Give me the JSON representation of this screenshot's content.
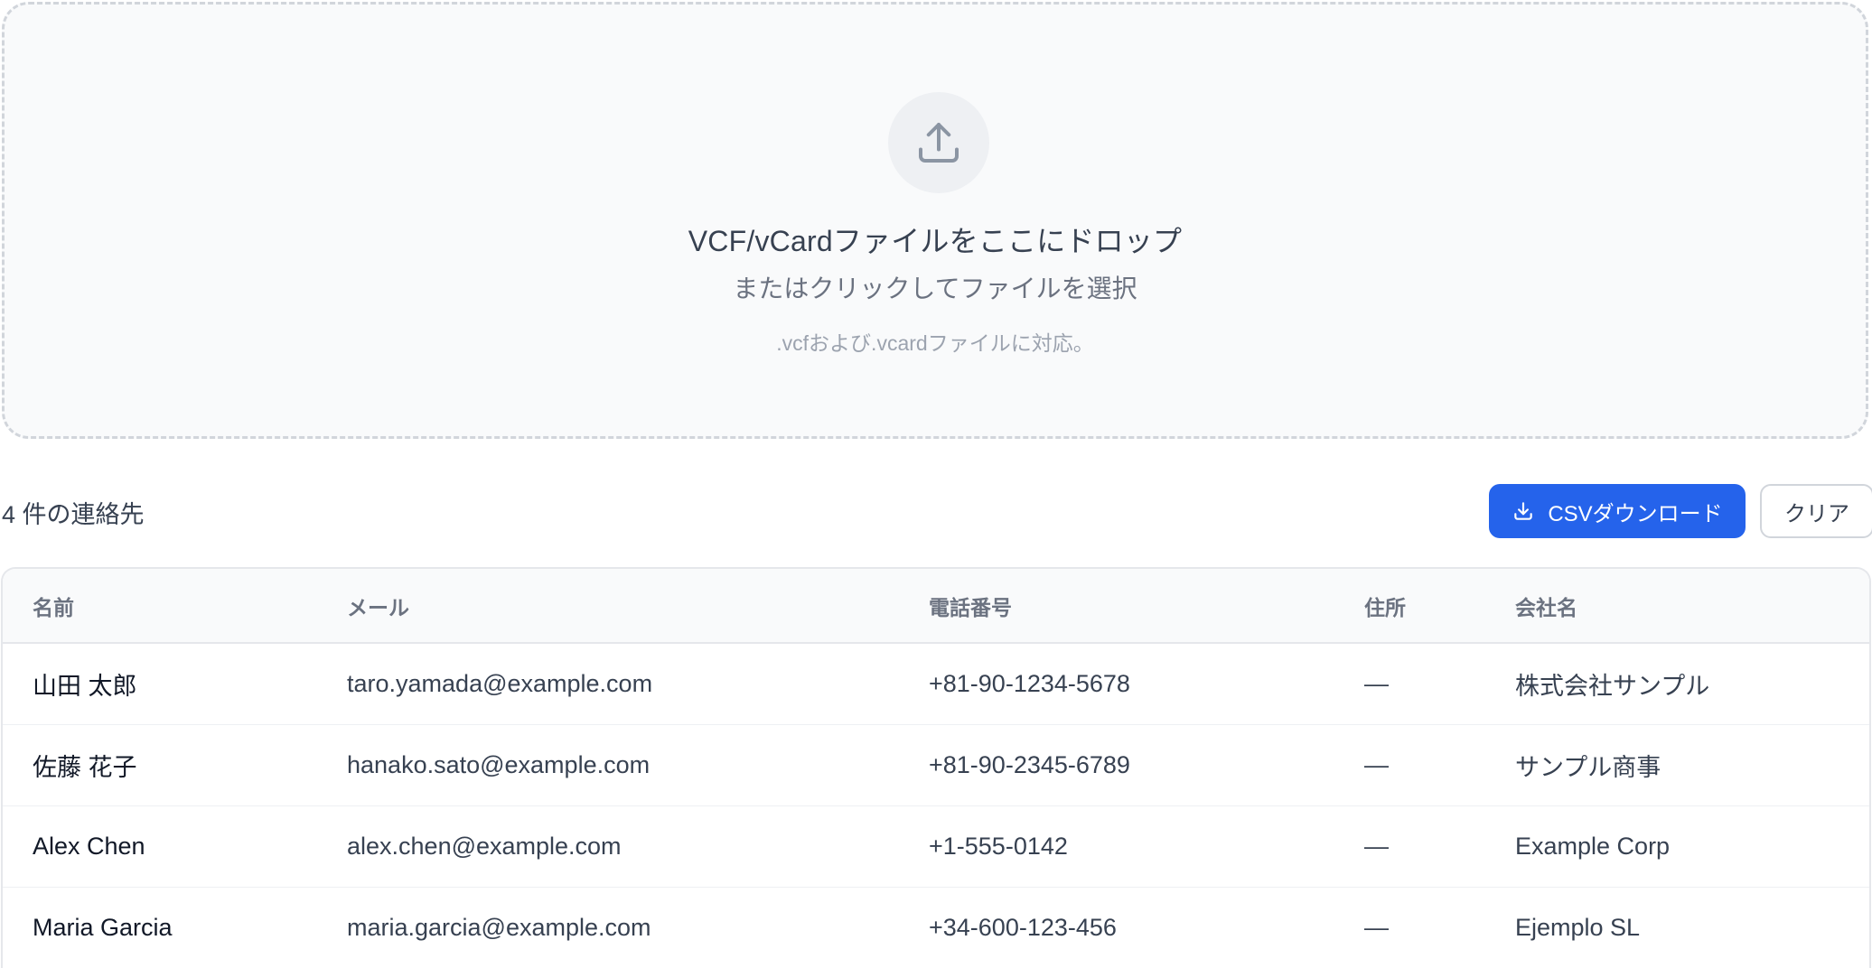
{
  "dropzone": {
    "icon": "upload-icon",
    "title": "VCF/vCardファイルをここにドロップ",
    "subtitle": "またはクリックしてファイルを選択",
    "note": ".vcfおよび.vcardファイルに対応。"
  },
  "toolbar": {
    "count_label": "4 件の連絡先",
    "download_label": "CSVダウンロード",
    "download_icon": "download-icon",
    "clear_label": "クリア"
  },
  "table": {
    "headers": {
      "name": "名前",
      "email": "メール",
      "phone": "電話番号",
      "address": "住所",
      "company": "会社名"
    },
    "rows": [
      {
        "name": "山田 太郎",
        "email": "taro.yamada@example.com",
        "phone": "+81-90-1234-5678",
        "address": "—",
        "company": "株式会社サンプル"
      },
      {
        "name": "佐藤 花子",
        "email": "hanako.sato@example.com",
        "phone": "+81-90-2345-6789",
        "address": "—",
        "company": "サンプル商事"
      },
      {
        "name": "Alex Chen",
        "email": "alex.chen@example.com",
        "phone": "+1-555-0142",
        "address": "—",
        "company": "Example Corp"
      },
      {
        "name": "Maria Garcia",
        "email": "maria.garcia@example.com",
        "phone": "+34-600-123-456",
        "address": "—",
        "company": "Ejemplo SL"
      }
    ]
  },
  "colors": {
    "accent": "#2563eb",
    "border": "#e5e7eb",
    "dropzone_bg": "#f9fafb"
  }
}
